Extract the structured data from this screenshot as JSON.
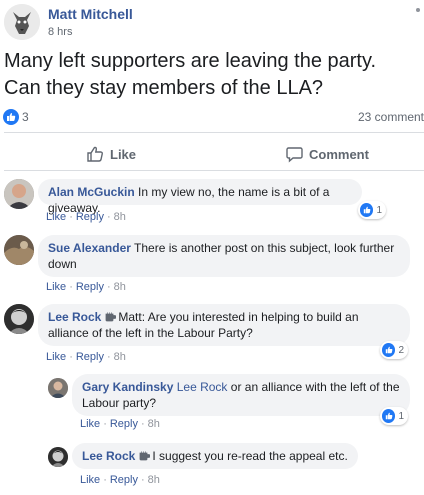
{
  "post": {
    "author": "Matt Mitchell",
    "time": "8 hrs",
    "text_line1": "Many left supporters are leaving the party.",
    "text_line2": "Can they stay members of the LLA?",
    "like_count": "3",
    "comment_count": "23 comment",
    "like_label": "Like",
    "comment_label": "Comment"
  },
  "comments": [
    {
      "author": "Alan McGuckin",
      "text": "In my view no, the name is a bit of a giveaway.",
      "reactions": "1"
    },
    {
      "author": "Sue Alexander",
      "text_line1": "There is another post on this subject, look further",
      "text_line2": "down"
    },
    {
      "author": "Lee Rock",
      "text_line1": "Matt: Are you interested in helping to build an",
      "text_line2": "alliance of the left in the Labour Party?",
      "reactions": "2"
    }
  ],
  "replies": [
    {
      "author": "Gary Kandinsky",
      "mention": "Lee Rock",
      "text_line1": "or an alliance with the left of the",
      "text_line2": "Labour party?",
      "reactions": "1"
    },
    {
      "author": "Lee Rock",
      "text": "I suggest you re-read the appeal etc."
    }
  ],
  "comment_actions": {
    "like": "Like",
    "reply": "Reply",
    "time": "8h"
  }
}
